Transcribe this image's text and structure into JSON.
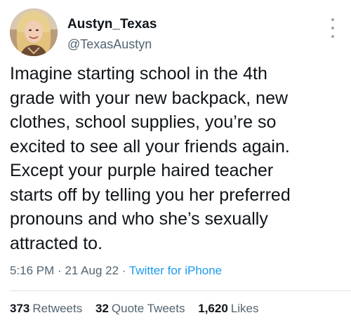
{
  "author": {
    "display_name": "Austyn_Texas",
    "handle": "@TexasAustyn",
    "avatar": "profile-photo"
  },
  "tweet": {
    "lines": [
      "Imagine starting school in the 4th",
      "grade with your new backpack, new",
      "clothes, school supplies, you’re so",
      "excited to see all your friends again.",
      "Except your purple haired teacher",
      "starts off by telling you her preferred",
      "pronouns and who she’s sexually",
      "attracted to."
    ],
    "time": "5:16 PM",
    "separator": "·",
    "date": "21 Aug 22",
    "source": "Twitter for iPhone"
  },
  "stats": {
    "retweets_count": "373",
    "retweets_label": "Retweets",
    "quotes_count": "32",
    "quotes_label": "Quote Tweets",
    "likes_count": "1,620",
    "likes_label": "Likes"
  },
  "icons": {
    "more": "more-options-icon"
  },
  "colors": {
    "text": "#0f1419",
    "secondary": "#536471",
    "link": "#1d9bf0"
  }
}
